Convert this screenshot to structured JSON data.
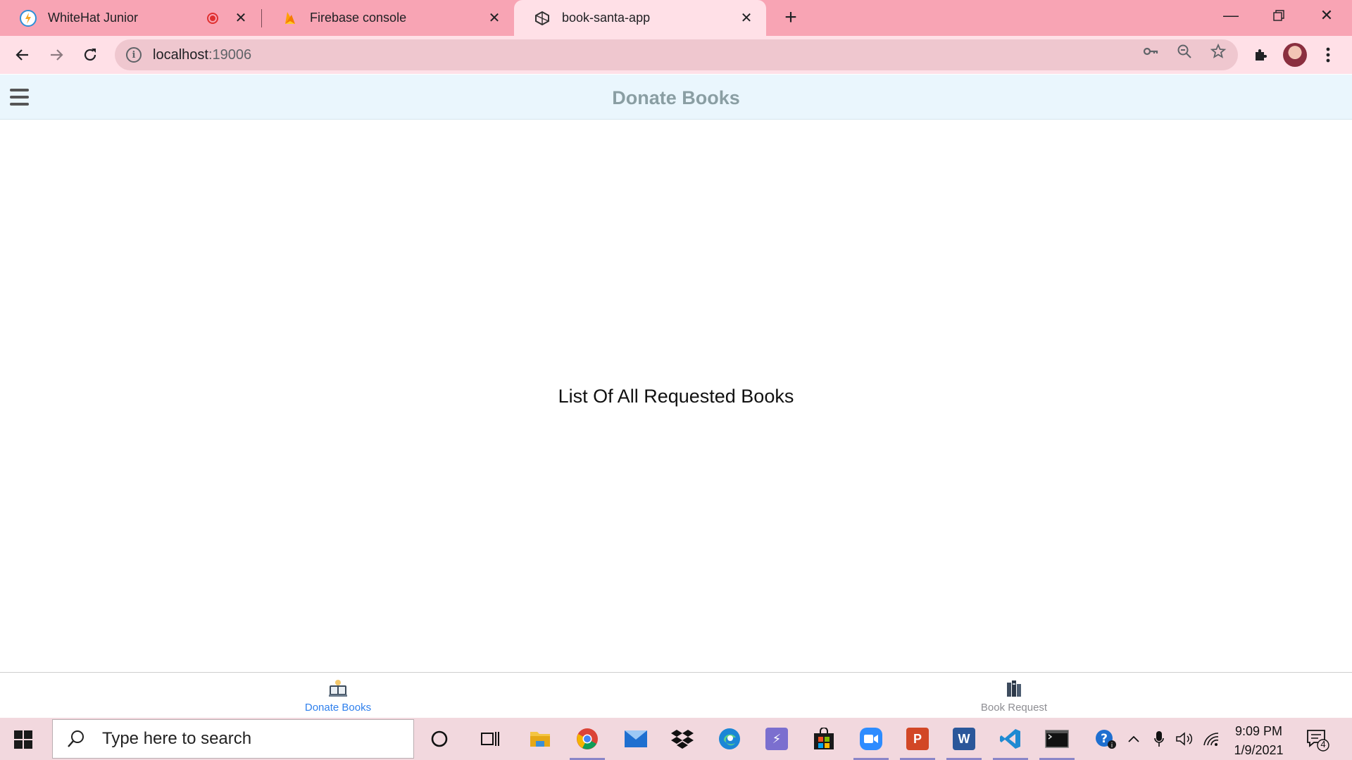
{
  "browser": {
    "tabs": [
      {
        "title": "WhiteHat Junior",
        "favicon": "whitehat-icon",
        "recording": true
      },
      {
        "title": "Firebase console",
        "favicon": "firebase-icon"
      },
      {
        "title": "book-santa-app",
        "favicon": "expo-icon",
        "active": true
      }
    ],
    "url_host": "localhost",
    "url_port": ":19006"
  },
  "app": {
    "header_title": "Donate Books",
    "main_text": "List Of All Requested Books",
    "bottom_tabs": [
      {
        "label": "Donate Books",
        "icon": "book-stack-icon",
        "active": true,
        "color": "#2f80ed"
      },
      {
        "label": "Book Request",
        "icon": "books-shelf-icon",
        "active": false,
        "color": "#8e8e93"
      }
    ]
  },
  "taskbar": {
    "search_placeholder": "Type here to search",
    "time": "9:09 PM",
    "date": "1/9/2021",
    "notification_count": "4"
  },
  "colors": {
    "tab_strip": "#f8a4b4",
    "toolbar": "#ffe0e7",
    "app_header_bg": "#eaf6fd",
    "app_header_text": "#8a9ea3",
    "active_tab_label": "#2f80ed",
    "inactive_tab_label": "#8e8e93",
    "taskbar": "#f2d8de"
  }
}
